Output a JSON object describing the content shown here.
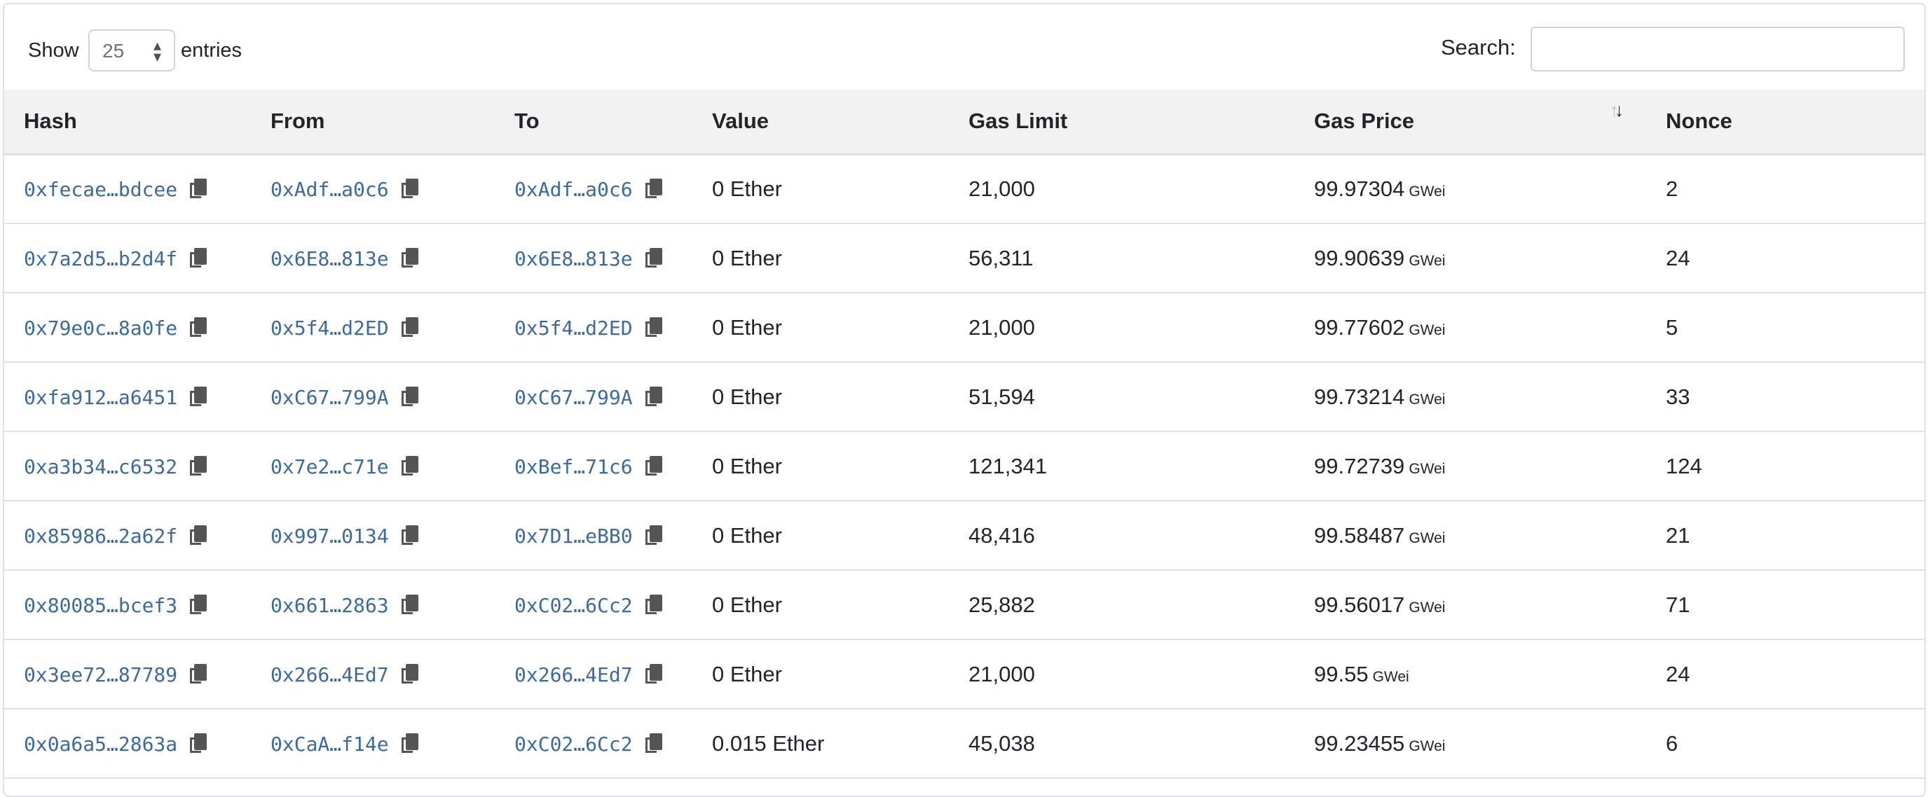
{
  "controls": {
    "show_label": "Show",
    "page_length": "25",
    "entries_label": "entries",
    "search_label": "Search:",
    "search_value": ""
  },
  "table": {
    "headers": [
      "Hash",
      "From",
      "To",
      "Value",
      "Gas Limit",
      "Gas Price",
      "Nonce"
    ],
    "sorted_column": "Gas Price",
    "sort_direction": "descending",
    "gas_unit": "GWei",
    "rows": [
      {
        "hash": "0xfecae…bdcee",
        "from": "0xAdf…a0c6",
        "to": "0xAdf…a0c6",
        "value": "0 Ether",
        "gas_limit": "21,000",
        "gas_price": "99.97304",
        "nonce": "2"
      },
      {
        "hash": "0x7a2d5…b2d4f",
        "from": "0x6E8…813e",
        "to": "0x6E8…813e",
        "value": "0 Ether",
        "gas_limit": "56,311",
        "gas_price": "99.90639",
        "nonce": "24"
      },
      {
        "hash": "0x79e0c…8a0fe",
        "from": "0x5f4…d2ED",
        "to": "0x5f4…d2ED",
        "value": "0 Ether",
        "gas_limit": "21,000",
        "gas_price": "99.77602",
        "nonce": "5"
      },
      {
        "hash": "0xfa912…a6451",
        "from": "0xC67…799A",
        "to": "0xC67…799A",
        "value": "0 Ether",
        "gas_limit": "51,594",
        "gas_price": "99.73214",
        "nonce": "33"
      },
      {
        "hash": "0xa3b34…c6532",
        "from": "0x7e2…c71e",
        "to": "0xBef…71c6",
        "value": "0 Ether",
        "gas_limit": "121,341",
        "gas_price": "99.72739",
        "nonce": "124"
      },
      {
        "hash": "0x85986…2a62f",
        "from": "0x997…0134",
        "to": "0x7D1…eBB0",
        "value": "0 Ether",
        "gas_limit": "48,416",
        "gas_price": "99.58487",
        "nonce": "21"
      },
      {
        "hash": "0x80085…bcef3",
        "from": "0x661…2863",
        "to": "0xC02…6Cc2",
        "value": "0 Ether",
        "gas_limit": "25,882",
        "gas_price": "99.56017",
        "nonce": "71"
      },
      {
        "hash": "0x3ee72…87789",
        "from": "0x266…4Ed7",
        "to": "0x266…4Ed7",
        "value": "0 Ether",
        "gas_limit": "21,000",
        "gas_price": "99.55",
        "nonce": "24"
      },
      {
        "hash": "0x0a6a5…2863a",
        "from": "0xCaA…f14e",
        "to": "0xC02…6Cc2",
        "value": "0.015 Ether",
        "gas_limit": "45,038",
        "gas_price": "99.23455",
        "nonce": "6"
      }
    ]
  },
  "colors": {
    "link": "#3a6aa5",
    "header_bg": "#f2f2f2",
    "border": "#dee2e6"
  },
  "icons": {
    "copy": "copy-icon",
    "sort": "sort-arrows-icon",
    "select_caret": "select-caret-icon"
  }
}
